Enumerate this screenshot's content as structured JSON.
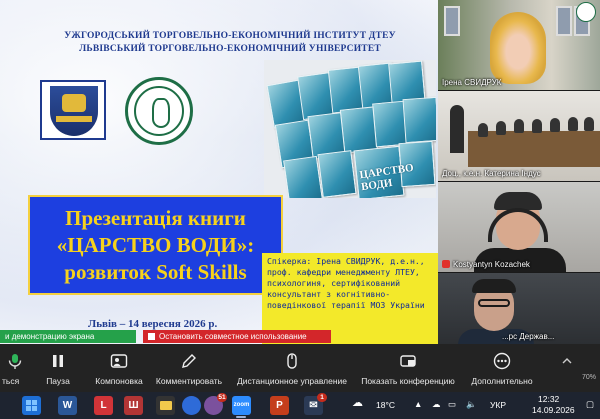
{
  "slide": {
    "header_line1": "УЖГОРОДСЬКИЙ ТОРГОВЕЛЬНО-ЕКОНОМІЧНИЙ ІНСТИТУТ ДТЕУ",
    "header_line2": "ЛЬВІВСЬКИЙ ТОРГОВЕЛЬНО-ЕКОНОМІЧНИЙ УНІВЕРСИТЕТ",
    "book_cover_title": "ЦАРСТВО ВОДИ",
    "title_line1": "Презентація книги",
    "title_line2": "«ЦАРСТВО ВОДИ»:",
    "title_line3": "розвиток Soft Skills",
    "speaker_text": "Спікерка: Ірена СВИДРУК, д.е.н., проф. кафедри менеджменту ЛТЕУ, психологиня, сертифікований консультант з когнітивно-поведінкової терапії МОЗ України",
    "date_text": "Львів – 14 вересня 2026 р."
  },
  "participants": [
    {
      "name": "Ірена СВИДРУК"
    },
    {
      "name": "Доц., к.е.н. Катерина Індус"
    },
    {
      "name": "Kostyantyn Kozachek",
      "muted": true
    },
    {
      "name": "...рс Держав..."
    }
  ],
  "share": {
    "showing_label": "и демонстрацию экрана",
    "stop_label": "Остановить совместное использование"
  },
  "toolbar": {
    "items": [
      {
        "label": "ться",
        "icon": "mic-icon"
      },
      {
        "label": "Пауза",
        "icon": "pause-icon"
      },
      {
        "label": "Компоновка",
        "icon": "layout-icon"
      },
      {
        "label": "Комментировать",
        "icon": "annotate-icon"
      },
      {
        "label": "Дистанционное управление",
        "icon": "mouse-icon"
      },
      {
        "label": "Показать конференцию",
        "icon": "show-meeting-icon"
      },
      {
        "label": "Дополнительно",
        "icon": "more-icon"
      }
    ],
    "percent": "70%"
  },
  "taskbar": {
    "weather": "18°C",
    "language": "УКР",
    "time": "12:32",
    "date": "14.09.2026",
    "badge_viber": "51",
    "badge_mail": "1"
  },
  "colors": {
    "title_bg": "#1d3fe0",
    "title_text": "#f7d21c",
    "speaker_bg": "#f3e92a",
    "share_green": "#25a14a",
    "share_red": "#d3262a",
    "toolbar_bg": "#232323",
    "taskbar_bg": "#1e2430"
  }
}
